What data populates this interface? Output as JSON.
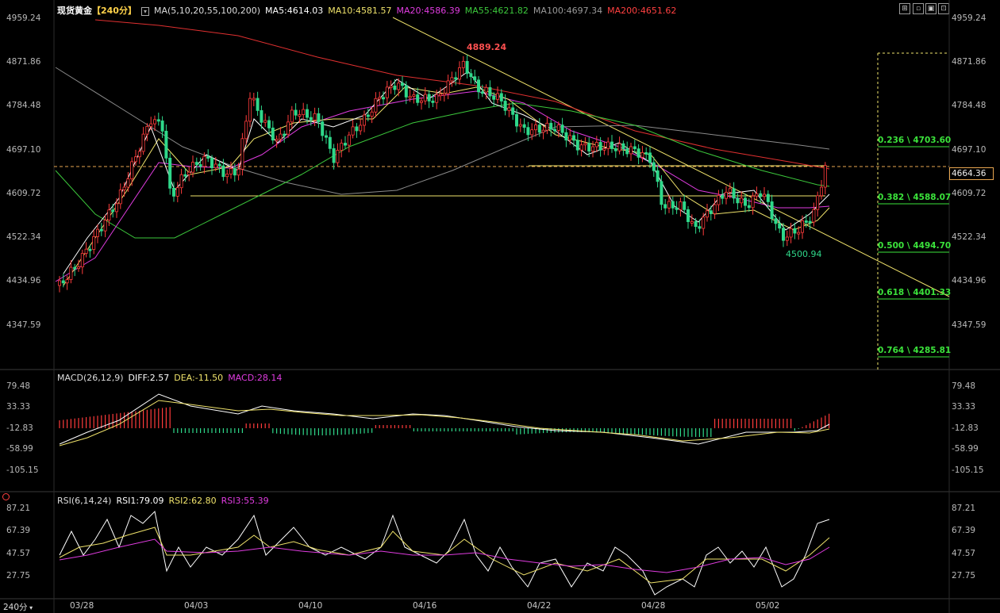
{
  "main_header": {
    "symbol": "现货黄金",
    "period_tag": "【240分】",
    "ma_params": "MA(5,10,20,55,100,200)",
    "ma5": "MA5:4614.03",
    "ma10": "MA10:4581.57",
    "ma20": "MA20:4586.39",
    "ma55": "MA55:4621.82",
    "ma100": "MA100:4697.34",
    "ma200": "MA200:4651.62"
  },
  "window_buttons": [
    "⊞",
    "▫",
    "▣",
    "⊡"
  ],
  "price_axis_left": [
    "4959.24",
    "4871.86",
    "4784.48",
    "4697.10",
    "4609.72",
    "4522.34",
    "4434.96",
    "4347.59"
  ],
  "price_axis_right": [
    "4959.24",
    "4871.86",
    "4784.48",
    "4697.10",
    "4609.72",
    "4522.34",
    "4434.96",
    "4347.59"
  ],
  "current_price": "4664.36",
  "annotations": {
    "high": "4889.24",
    "low": "4500.94"
  },
  "fibonacci": [
    "0.236 \\ 4703.60",
    "0.382 \\ 4588.07",
    "0.500 \\ 4494.70",
    "0.618 \\ 4401.33",
    "0.764 \\ 4285.81"
  ],
  "macd_header": {
    "params": "MACD(26,12,9)",
    "diff": "DIFF:2.57",
    "dea": "DEA:-11.50",
    "macd": "MACD:28.14"
  },
  "macd_axis": [
    "79.48",
    "33.33",
    "-12.83",
    "-58.99",
    "-105.15"
  ],
  "rsi_header": {
    "params": "RSI(6,14,24)",
    "rsi1": "RSI1:79.09",
    "rsi2": "RSI2:62.80",
    "rsi3": "RSI3:55.39"
  },
  "rsi_axis": [
    "87.21",
    "67.39",
    "47.57",
    "27.75"
  ],
  "period_label": "240分",
  "date_axis": [
    "03/28",
    "04/03",
    "04/10",
    "04/16",
    "04/22",
    "04/28",
    "05/02"
  ],
  "colors": {
    "up": "#ff3b3b",
    "down": "#2fd88a",
    "ma5": "#ffffff",
    "ma10": "#f0e36b",
    "ma20": "#e03ce0",
    "ma55": "#3cc83c",
    "ma100": "#8a8a8a",
    "ma200": "#e03030",
    "fib": "#3be33b"
  }
}
